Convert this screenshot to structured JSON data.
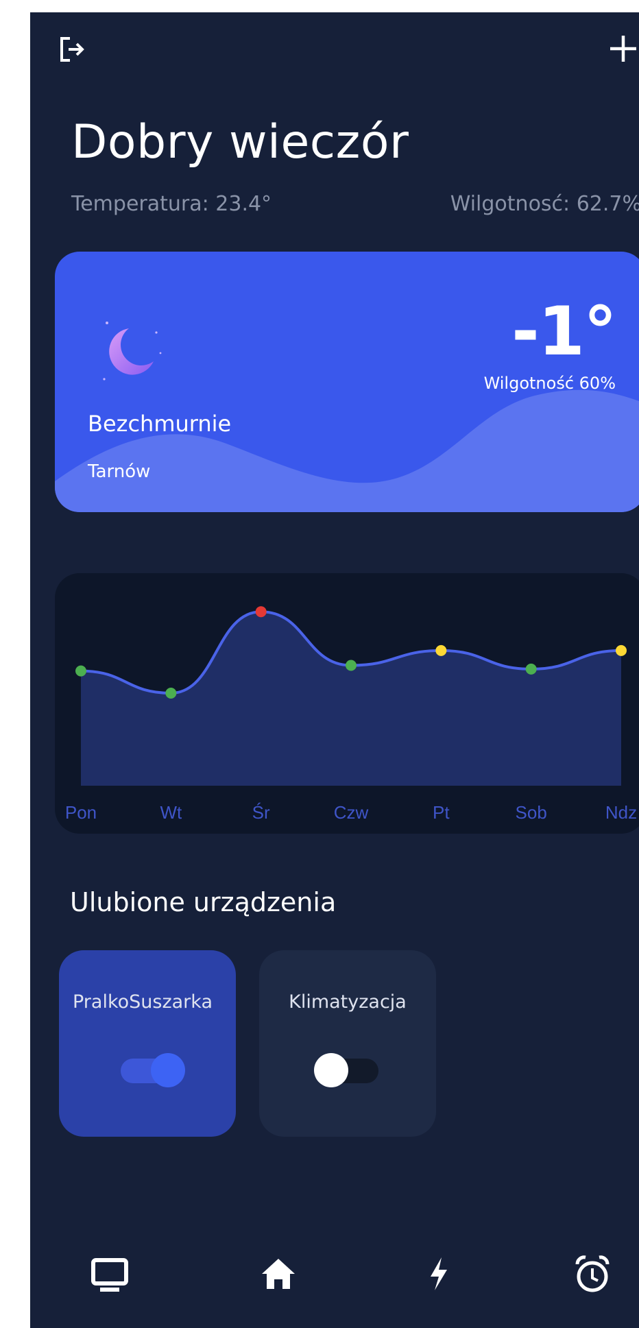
{
  "header": {
    "logout_icon": "logout-icon",
    "add_icon": "plus-icon"
  },
  "greeting": "Dobry wieczór",
  "indoor": {
    "temperature": "Temperatura: 23.4°",
    "humidity": "Wilgotnosć: 62.7%"
  },
  "weather": {
    "icon": "moon-icon",
    "condition": "Bezchmurnie",
    "city": "Tarnów",
    "temperature": "-1°",
    "humidity": "Wilgotność 60%",
    "colors": {
      "card": "#3a58ec",
      "wave": "#5b74f0",
      "moon": "#b57cf5"
    }
  },
  "chart_data": {
    "type": "area",
    "categories": [
      "Pon",
      "Wt",
      "Śr",
      "Czw",
      "Pt",
      "Sob",
      "Ndz"
    ],
    "values": [
      0.62,
      0.5,
      0.94,
      0.65,
      0.73,
      0.63,
      0.73
    ],
    "point_colors": [
      "#4caf50",
      "#4caf50",
      "#e53935",
      "#4caf50",
      "#fdd835",
      "#4caf50",
      "#fdd835"
    ],
    "ylim": [
      0,
      1
    ],
    "grid": false,
    "line_color": "#4a63e8",
    "area_color": "#1f2e66"
  },
  "favorites": {
    "title": "Ulubione urządzenia",
    "devices": [
      {
        "name": "PralkoSuszarka",
        "on": true
      },
      {
        "name": "Klimatyzacja",
        "on": false
      }
    ]
  },
  "bottom_nav": [
    {
      "icon": "monitor-icon"
    },
    {
      "icon": "home-icon"
    },
    {
      "icon": "lightning-icon"
    },
    {
      "icon": "alarm-clock-icon"
    }
  ]
}
